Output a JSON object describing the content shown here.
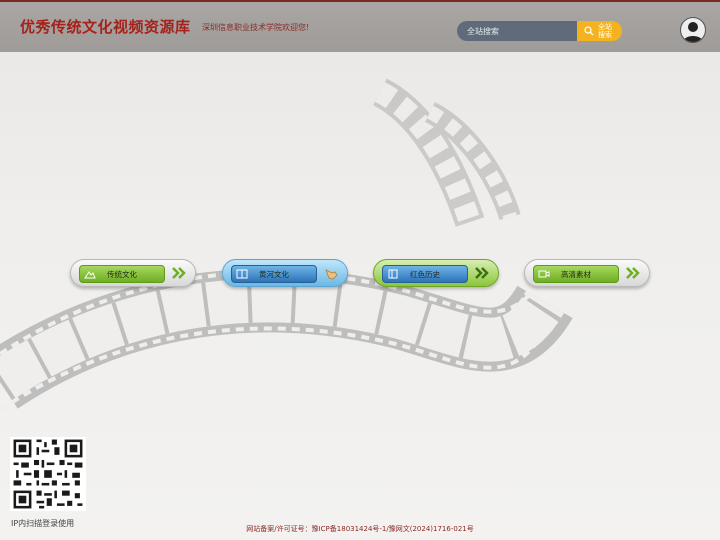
{
  "header": {
    "site_title": "优秀传统文化视频资源库",
    "welcome": "深圳信息职业技术学院欢迎您!",
    "search_placeholder": "全站搜索",
    "search_button_line1": "全站",
    "search_button_line2": "搜索",
    "avatar_icon": "user-avatar-icon"
  },
  "nav": [
    {
      "label": "传统文化",
      "icon": "mountain-icon",
      "style": "green"
    },
    {
      "label": "黄河文化",
      "icon": "book-icon",
      "style": "blue"
    },
    {
      "label": "红色历史",
      "icon": "flag-icon",
      "style": "green"
    },
    {
      "label": "高清素材",
      "icon": "camera-icon",
      "style": "green"
    }
  ],
  "qr": {
    "caption": "IP内扫描登录使用"
  },
  "footer": {
    "text": "网站备案/许可证号：豫ICP备18031424号-1/豫网文(2024)1716-021号"
  },
  "colors": {
    "brand_red": "#a5221a",
    "header_bg": "#a9a6a3",
    "search_bg": "#5f6b7b",
    "search_btn": "#f5b21f",
    "nav_green": "#6fae22",
    "nav_blue": "#2d74b8"
  }
}
